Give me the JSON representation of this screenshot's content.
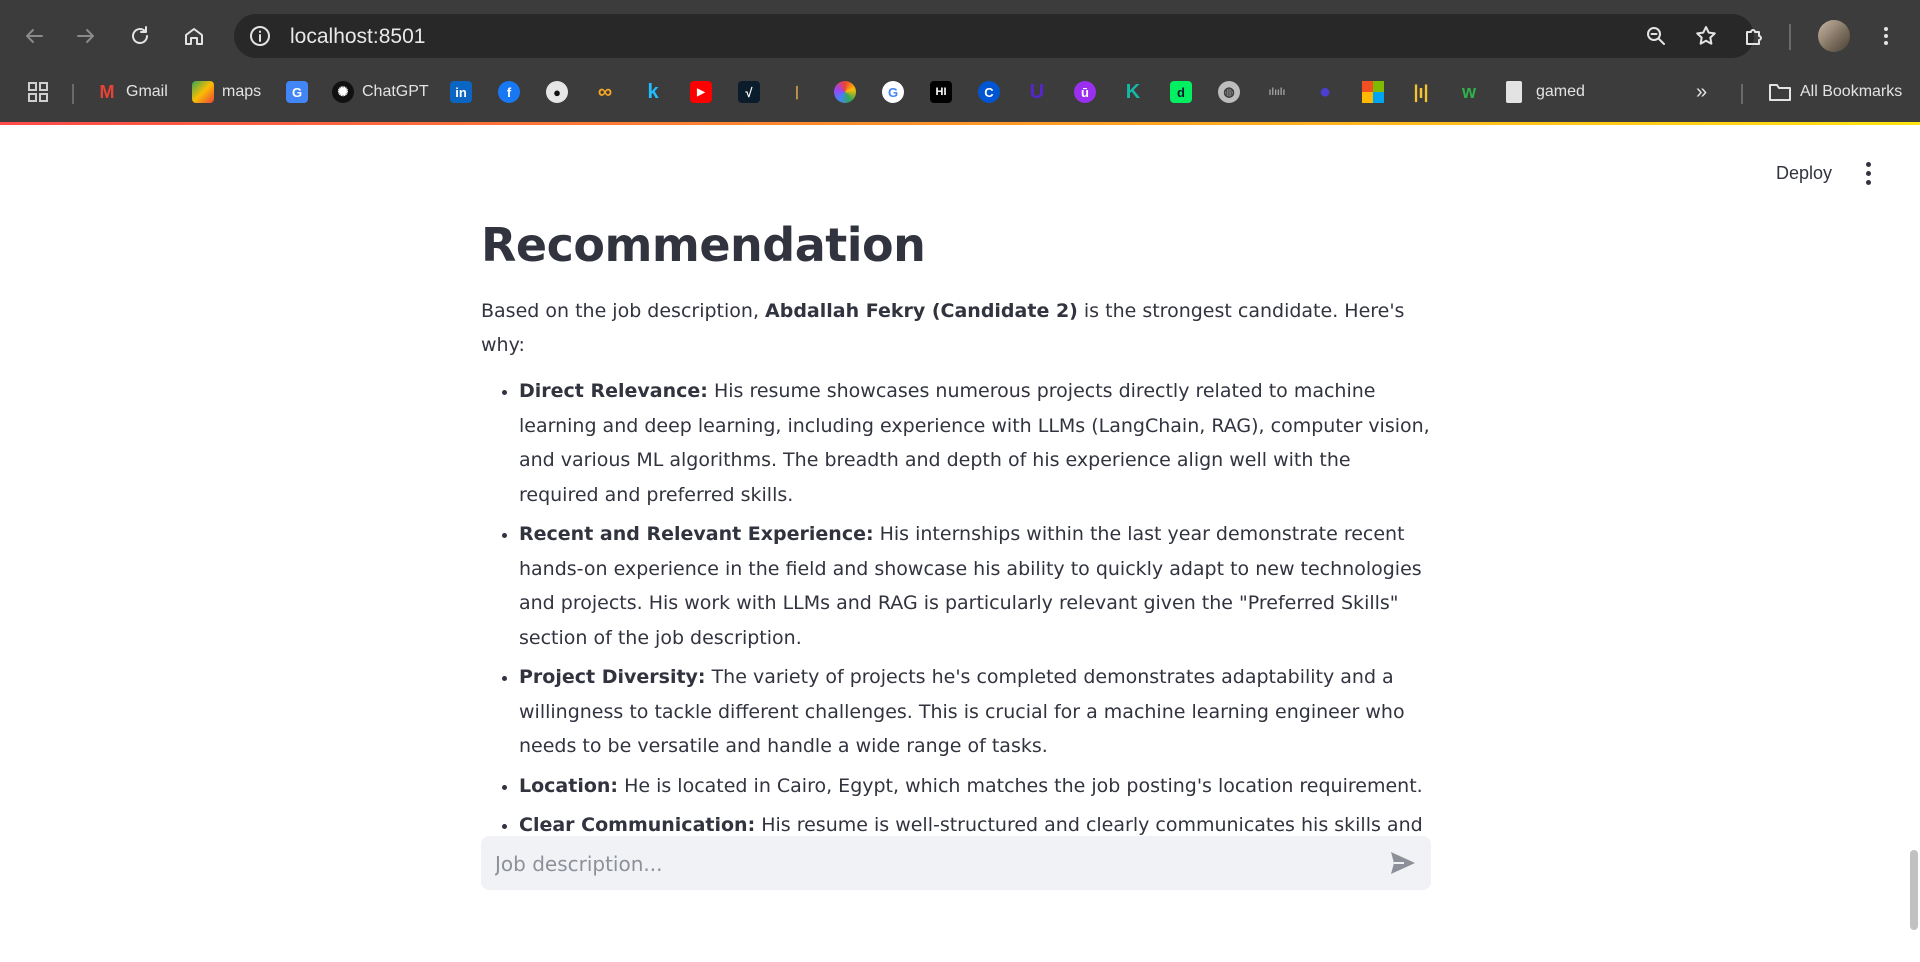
{
  "browser": {
    "url": "localhost:8501",
    "bookmarks": [
      {
        "label": "Gmail",
        "icon": "gmail-icon"
      },
      {
        "label": "maps",
        "icon": "maps-icon"
      },
      {
        "label": "",
        "icon": "google-translate-icon"
      },
      {
        "label": "ChatGPT",
        "icon": "chatgpt-icon"
      },
      {
        "label": "",
        "icon": "linkedin-icon"
      },
      {
        "label": "",
        "icon": "facebook-icon"
      },
      {
        "label": "",
        "icon": "github-icon"
      },
      {
        "label": "",
        "icon": "infinity-icon"
      },
      {
        "label": "",
        "icon": "kaggle-icon"
      },
      {
        "label": "",
        "icon": "youtube-icon"
      },
      {
        "label": "",
        "icon": "bookmark-icon"
      },
      {
        "label": "",
        "icon": "bookmark-icon"
      },
      {
        "label": "",
        "icon": "bookmark-icon"
      },
      {
        "label": "",
        "icon": "google-icon"
      },
      {
        "label": "",
        "icon": "bookmark-icon"
      },
      {
        "label": "",
        "icon": "coursera-icon"
      },
      {
        "label": "",
        "icon": "udemy-icon"
      },
      {
        "label": "",
        "icon": "bookmark-icon"
      },
      {
        "label": "",
        "icon": "bookmark-icon"
      },
      {
        "label": "",
        "icon": "datacamp-icon"
      },
      {
        "label": "",
        "icon": "globe-icon"
      },
      {
        "label": "",
        "icon": "cisco-icon"
      },
      {
        "label": "",
        "icon": "bookmark-icon"
      },
      {
        "label": "",
        "icon": "microsoft-icon"
      },
      {
        "label": "",
        "icon": "bookmark-icon"
      },
      {
        "label": "",
        "icon": "bookmark-icon"
      },
      {
        "label": "gamed",
        "icon": "document-icon"
      }
    ],
    "all_bookmarks_label": "All Bookmarks"
  },
  "app": {
    "deploy_label": "Deploy",
    "heading": "Recommendation",
    "intro": {
      "before": "Based on the job description, ",
      "bold": "Abdallah Fekry (Candidate 2)",
      "after": " is the strongest candidate. Here's why:"
    },
    "reasons": [
      {
        "title": "Direct Relevance:",
        "text": " His resume showcases numerous projects directly related to machine learning and deep learning, including experience with LLMs (LangChain, RAG), computer vision, and various ML algorithms. The breadth and depth of his experience align well with the required and preferred skills."
      },
      {
        "title": "Recent and Relevant Experience:",
        "text": " His internships within the last year demonstrate recent hands-on experience in the field and showcase his ability to quickly adapt to new technologies and projects. His work with LLMs and RAG is particularly relevant given the \"Preferred Skills\" section of the job description."
      },
      {
        "title": "Project Diversity:",
        "text": " The variety of projects he's completed demonstrates adaptability and a willingness to tackle different challenges. This is crucial for a machine learning engineer who needs to be versatile and handle a wide range of tasks."
      },
      {
        "title": "Location:",
        "text": " He is located in Cairo, Egypt, which matches the job posting's location requirement."
      },
      {
        "title": "Clear Communication:",
        "text": " His resume is well-structured and clearly communicates his skills and accomplishments."
      }
    ],
    "chat_placeholder": "Job description..."
  }
}
